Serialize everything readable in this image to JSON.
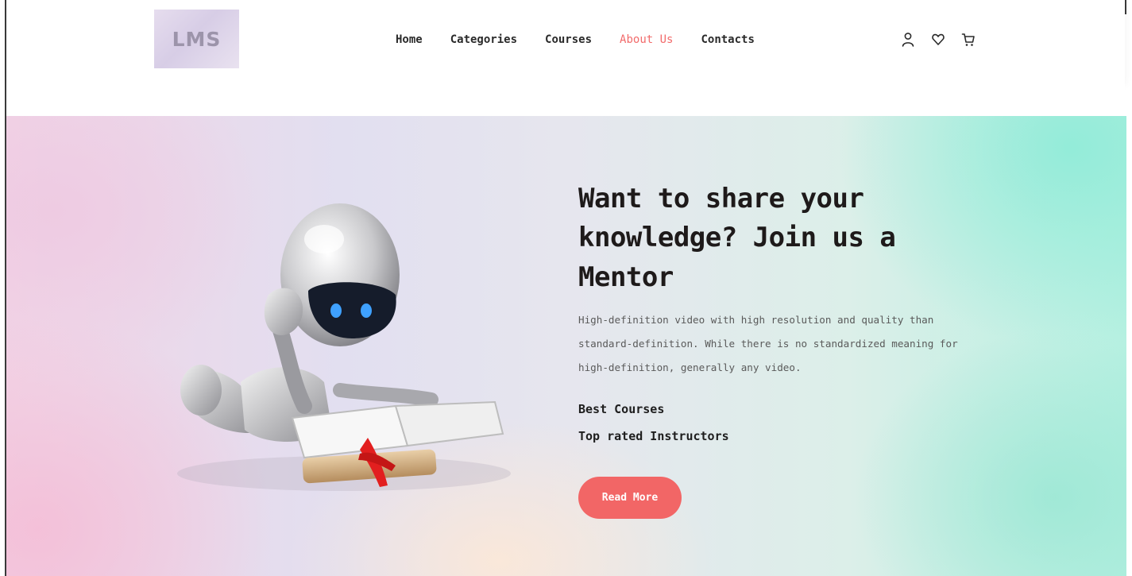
{
  "header": {
    "logo_text": "LMS",
    "nav": [
      {
        "label": "Home",
        "active": false
      },
      {
        "label": "Categories",
        "active": false
      },
      {
        "label": "Courses",
        "active": false
      },
      {
        "label": "About Us",
        "active": true
      },
      {
        "label": "Contacts",
        "active": false
      }
    ],
    "icons": [
      "user-icon",
      "heart-icon",
      "cart-icon"
    ]
  },
  "hero": {
    "title": "Want to share your knowledge? Join us a Mentor",
    "description": "High-definition video with high resolution and quality than standard-definition. While there is no standardized meaning for high-definition, generally any video.",
    "features": [
      "Best Courses",
      "Top rated Instructors"
    ],
    "button_label": "Read More",
    "image": "robot-reading-book-illustration"
  },
  "colors": {
    "accent": "#f26666",
    "active_nav": "#f26b6b",
    "text_dark": "#1e1a1a"
  }
}
